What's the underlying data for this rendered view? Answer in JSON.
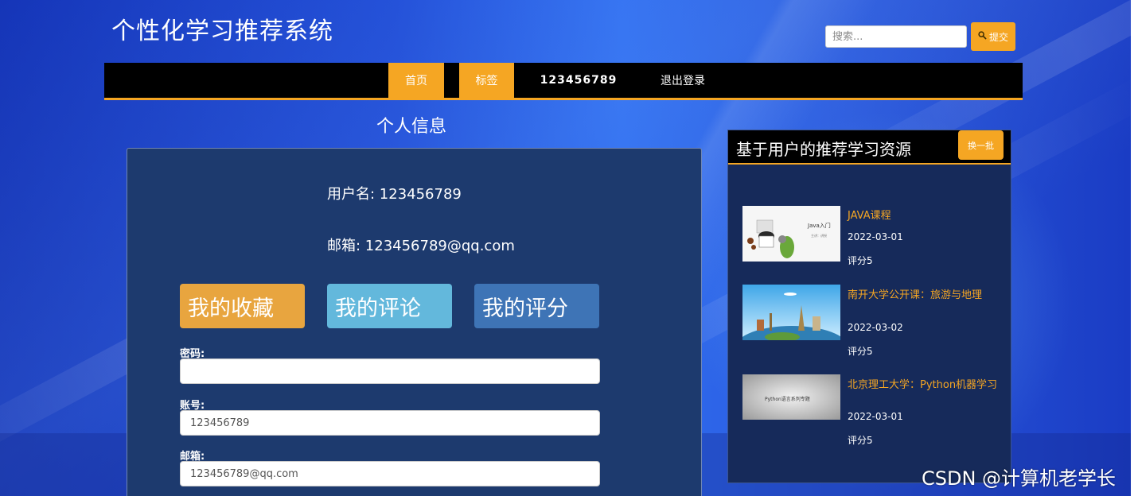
{
  "header": {
    "site_title": "个性化学习推荐系统",
    "search_placeholder": "搜索...",
    "submit_label": "提交",
    "submit_icon": "search-icon"
  },
  "nav": {
    "items": [
      {
        "label": "首页",
        "active": true
      },
      {
        "label": "标签",
        "active": true
      },
      {
        "label": "123456789",
        "active": false
      },
      {
        "label": "退出登录",
        "active": false
      }
    ]
  },
  "profile": {
    "section_title": "个人信息",
    "username_line": "用户名: 123456789",
    "email_line": "邮箱: 123456789@qq.com",
    "buttons": [
      {
        "label": "我的收藏",
        "color": "#e8a53f"
      },
      {
        "label": "我的评论",
        "color": "#63b8dc"
      },
      {
        "label": "我的评分",
        "color": "#3e74b6"
      }
    ],
    "fields": [
      {
        "label": "密码:",
        "value": ""
      },
      {
        "label": "账号:",
        "value": "123456789"
      },
      {
        "label": "邮箱:",
        "value": "123456789@qq.com"
      }
    ]
  },
  "recommend": {
    "title": "基于用户的推荐学习资源",
    "refresh_label": "换一批",
    "items": [
      {
        "name": "JAVA课程",
        "date": "2022-03-01",
        "score": "评分5",
        "thumb_text": "Java入门",
        "thumb_sub": "主讲：讲授"
      },
      {
        "name": "南开大学公开课：旅游与地理",
        "date": "2022-03-02",
        "score": "评分5",
        "thumb_text": "",
        "thumb_sub": ""
      },
      {
        "name": "北京理工大学：Python机器学习",
        "date": "2022-03-01",
        "score": "评分5",
        "thumb_text": "Python语言系列专题",
        "thumb_sub": ""
      }
    ]
  },
  "watermark": "CSDN @计算机老学长",
  "colors": {
    "accent": "#f5a623",
    "nav_bg": "#000000",
    "panel_bg": "#1d3a6e"
  }
}
